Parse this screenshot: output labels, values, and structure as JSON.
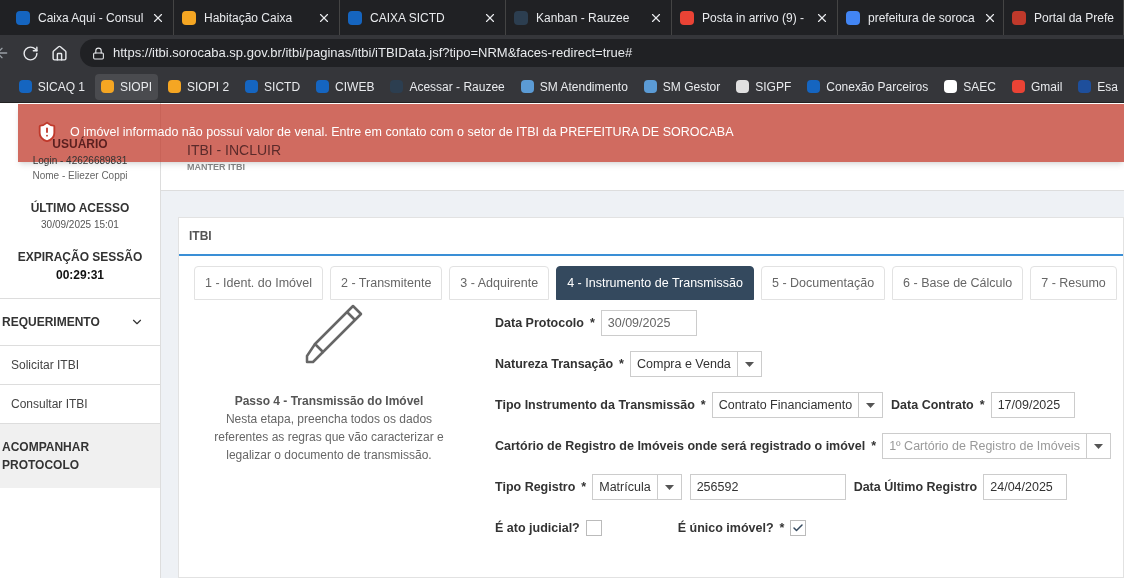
{
  "browser_tabs": [
    {
      "title": "Caixa Aqui - Consul",
      "selected": false,
      "color": "#1565c0"
    },
    {
      "title": "Habitação Caixa",
      "selected": false,
      "color": "#f5a623"
    },
    {
      "title": "CAIXA SICTD",
      "selected": false,
      "color": "#1565c0"
    },
    {
      "title": "Kanban - Rauzee",
      "selected": false,
      "color": "#2c3e50"
    },
    {
      "title": "Posta in arrivo (9) -",
      "selected": false,
      "color": "#ea4335"
    },
    {
      "title": "prefeitura de soroca",
      "selected": false,
      "color": "#4285f4"
    },
    {
      "title": "Portal da Prefe",
      "selected": false,
      "color": "#c0392b"
    }
  ],
  "address_bar": {
    "url": "https://itbi.sorocaba.sp.gov.br/itbi/paginas/itbi/iTBIData.jsf?tipo=NRM&faces-redirect=true#"
  },
  "bookmarks": [
    {
      "label": "SICAQ 1",
      "selected": false,
      "color": "#1565c0"
    },
    {
      "label": "SIOPI",
      "selected": true,
      "color": "#f5a623"
    },
    {
      "label": "SIOPI 2",
      "selected": false,
      "color": "#f5a623"
    },
    {
      "label": "SICTD",
      "selected": false,
      "color": "#1565c0"
    },
    {
      "label": "CIWEB",
      "selected": false,
      "color": "#1565c0"
    },
    {
      "label": "Acessar - Rauzee",
      "selected": false,
      "color": "#2c3e50"
    },
    {
      "label": "SM Atendimento",
      "selected": false,
      "color": "#5b9bd5"
    },
    {
      "label": "SM Gestor",
      "selected": false,
      "color": "#5b9bd5"
    },
    {
      "label": "SIGPF",
      "selected": false,
      "color": "#e0e0e0"
    },
    {
      "label": "Conexão Parceiros",
      "selected": false,
      "color": "#1565c0"
    },
    {
      "label": "SAEC",
      "selected": false,
      "color": "#ffffff"
    },
    {
      "label": "Gmail",
      "selected": false,
      "color": "#ea4335"
    },
    {
      "label": "Esa",
      "selected": false,
      "color": "#1e4f9c"
    }
  ],
  "alert": {
    "message": "O imóvel informado não possuí valor de venal. Entre em contato com o setor de ITBI da PREFEITURA DE SOROCABA"
  },
  "sidebar": {
    "user_heading": "USUÁRIO",
    "login": "Login - 42626689831",
    "name": "Nome - Eliezer Coppi",
    "last_access_heading": "ÚLTIMO ACESSO",
    "last_access": "30/09/2025 15:01",
    "session_heading": "EXPIRAÇÃO SESSÃO",
    "session_time": "00:29:31",
    "menu": [
      {
        "label": "REQUERIMENTO",
        "expanded": true,
        "children": [
          {
            "label": "Solicitar ITBI"
          },
          {
            "label": "Consultar ITBI"
          }
        ]
      },
      {
        "label": "ACOMPANHAR PROTOCOLO",
        "expanded": false
      }
    ]
  },
  "page_header": {
    "title": "ITBI - INCLUIR",
    "subtitle": "MANTER ITBI"
  },
  "card": {
    "title": "ITBI",
    "steps": [
      {
        "label": "1 - Ident. do Imóvel",
        "selected": false
      },
      {
        "label": "2 - Transmitente",
        "selected": false
      },
      {
        "label": "3 - Adquirente",
        "selected": false
      },
      {
        "label": "4 - Instrumento de Transmissão",
        "selected": true
      },
      {
        "label": "5 - Documentação",
        "selected": false
      },
      {
        "label": "6 - Base de Cálculo",
        "selected": false
      },
      {
        "label": "7 - Resumo",
        "selected": false
      }
    ],
    "step_info": {
      "title": "Passo 4 - Transmissão do Imóvel",
      "description": "Nesta etapa, preencha todos os dados referentes as regras que vão caracterizar e legalizar o documento de transmissão."
    },
    "form_rows": [
      [
        {
          "kind": "input",
          "label": "Data Protocolo",
          "required_mark": "*",
          "value": "30/09/2025",
          "disabled": true
        }
      ],
      [
        {
          "kind": "select",
          "label": "Natureza Transação",
          "required_mark": "*",
          "value": "Compra e Venda",
          "disabled": false
        }
      ],
      [
        {
          "kind": "select",
          "label": "Tipo Instrumento da Transmissão",
          "required_mark": "*",
          "value": "Contrato Financiamento",
          "disabled": false
        },
        {
          "kind": "input",
          "label": "Data Contrato",
          "required_mark": "*",
          "value": "17/09/2025",
          "disabled": false
        }
      ],
      [
        {
          "kind": "select",
          "label": "Cartório de Registro de Imóveis onde será registrado o imóvel",
          "required_mark": "*",
          "value": "1º Cartório de Registro de Imóveis",
          "disabled": true
        }
      ],
      [
        {
          "kind": "select",
          "label": "Tipo Registro",
          "required_mark": "*",
          "value": "Matrícula",
          "disabled": false
        },
        {
          "kind": "input",
          "value": "256592",
          "disabled": false
        },
        {
          "kind": "input",
          "label": "Data Último Registro",
          "value": "24/04/2025",
          "disabled": false
        }
      ],
      [
        {
          "kind": "checkbox",
          "label": "É ato judicial?",
          "checked": false
        },
        {
          "kind": "checkbox",
          "label": "É único imóvel?",
          "required_mark": "*",
          "checked": true
        }
      ]
    ]
  }
}
